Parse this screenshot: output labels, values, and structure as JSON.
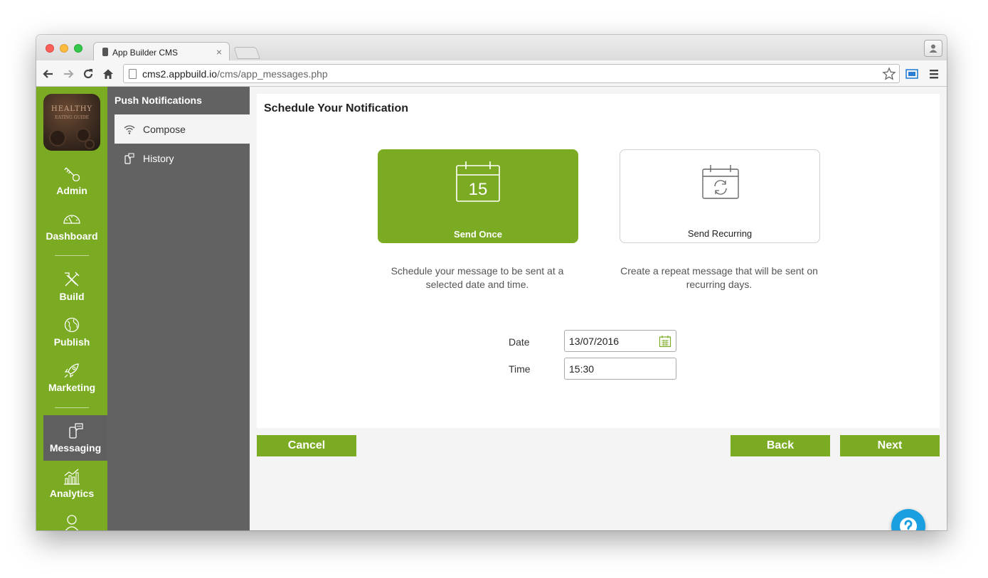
{
  "browser": {
    "tab_title": "App Builder CMS",
    "tab_close": "×",
    "url_host": "cms2.appbuild.io",
    "url_path": "/cms/app_messages.php"
  },
  "app_logo": {
    "text": "HEALTHY",
    "subtext": "EATING GUIDE"
  },
  "sidebar": {
    "items": [
      {
        "label": "Admin",
        "icon": "key-icon"
      },
      {
        "label": "Dashboard",
        "icon": "speedometer-icon"
      },
      {
        "label": "Build",
        "icon": "tools-icon"
      },
      {
        "label": "Publish",
        "icon": "globe-icon"
      },
      {
        "label": "Marketing",
        "icon": "rocket-icon"
      },
      {
        "label": "Messaging",
        "icon": "phone-chat-icon",
        "active": true
      },
      {
        "label": "Analytics",
        "icon": "analytics-icon"
      },
      {
        "label": "",
        "icon": "user-icon"
      }
    ]
  },
  "subnav": {
    "title": "Push Notifications",
    "items": [
      {
        "label": "Compose",
        "icon": "wifi-signal-icon",
        "active": true
      },
      {
        "label": "History",
        "icon": "phone-history-icon"
      }
    ]
  },
  "main": {
    "title": "Schedule Your Notification",
    "options": [
      {
        "label": "Send Once",
        "calendar_day": "15",
        "description": "Schedule your message to be sent at a selected date and time.",
        "selected": true
      },
      {
        "label": "Send Recurring",
        "description": "Create a repeat message that will be sent on recurring days.",
        "selected": false
      }
    ],
    "date_label": "Date",
    "date_value": "13/07/2016",
    "time_label": "Time",
    "time_value": "15:30"
  },
  "buttons": {
    "cancel": "Cancel",
    "back": "Back",
    "next": "Next"
  },
  "colors": {
    "brand_green": "#7aab23",
    "sidebar_grey": "#626262",
    "help_blue": "#1a9fe0"
  }
}
